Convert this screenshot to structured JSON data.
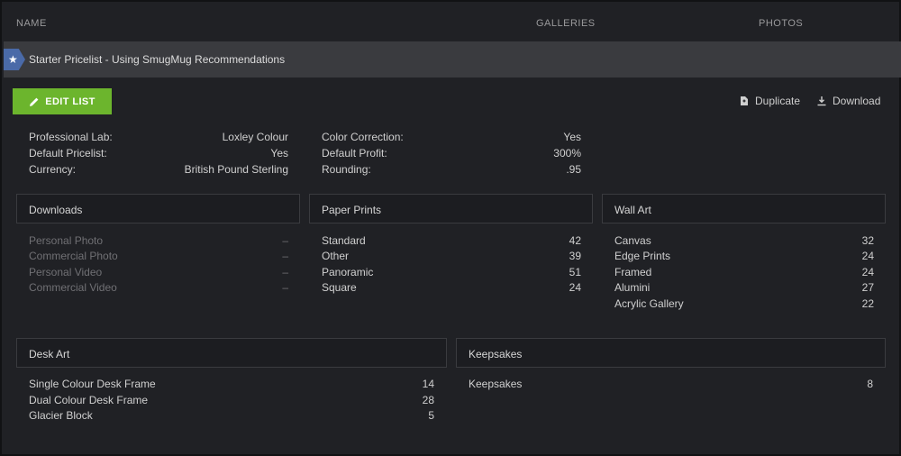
{
  "columns": {
    "name": "NAME",
    "galleries": "GALLERIES",
    "photos": "PHOTOS"
  },
  "row": {
    "title": "Starter Pricelist - Using SmugMug Recommendations",
    "star": "★"
  },
  "actions": {
    "edit": "EDIT LIST",
    "duplicate": "Duplicate",
    "download": "Download"
  },
  "details_left": [
    {
      "label": "Professional Lab:",
      "value": "Loxley Colour"
    },
    {
      "label": "Default Pricelist:",
      "value": "Yes"
    },
    {
      "label": "Currency:",
      "value": "British Pound Sterling"
    }
  ],
  "details_right": [
    {
      "label": "Color Correction:",
      "value": "Yes"
    },
    {
      "label": "Default Profit:",
      "value": "300%"
    },
    {
      "label": "Rounding:",
      "value": ".95"
    }
  ],
  "sections": {
    "downloads": {
      "title": "Downloads",
      "items": [
        {
          "label": "Personal Photo",
          "value": "–"
        },
        {
          "label": "Commercial Photo",
          "value": "–"
        },
        {
          "label": "Personal Video",
          "value": "–"
        },
        {
          "label": "Commercial Video",
          "value": "–"
        }
      ]
    },
    "paper_prints": {
      "title": "Paper Prints",
      "items": [
        {
          "label": "Standard",
          "value": "42"
        },
        {
          "label": "Other",
          "value": "39"
        },
        {
          "label": "Panoramic",
          "value": "51"
        },
        {
          "label": "Square",
          "value": "24"
        }
      ]
    },
    "wall_art": {
      "title": "Wall Art",
      "items": [
        {
          "label": "Canvas",
          "value": "32"
        },
        {
          "label": "Edge Prints",
          "value": "24"
        },
        {
          "label": "Framed",
          "value": "24"
        },
        {
          "label": "Alumini",
          "value": "27"
        },
        {
          "label": "Acrylic Gallery",
          "value": "22"
        }
      ]
    },
    "desk_art": {
      "title": "Desk Art",
      "items": [
        {
          "label": "Single Colour Desk Frame",
          "value": "14"
        },
        {
          "label": "Dual Colour Desk Frame",
          "value": "28"
        },
        {
          "label": "Glacier Block",
          "value": "5"
        }
      ]
    },
    "keepsakes": {
      "title": "Keepsakes",
      "items": [
        {
          "label": "Keepsakes",
          "value": "8"
        }
      ]
    }
  },
  "colors": {
    "accent_green": "#6cb52d",
    "star_blue": "#4a6aa8",
    "background": "#202125"
  }
}
